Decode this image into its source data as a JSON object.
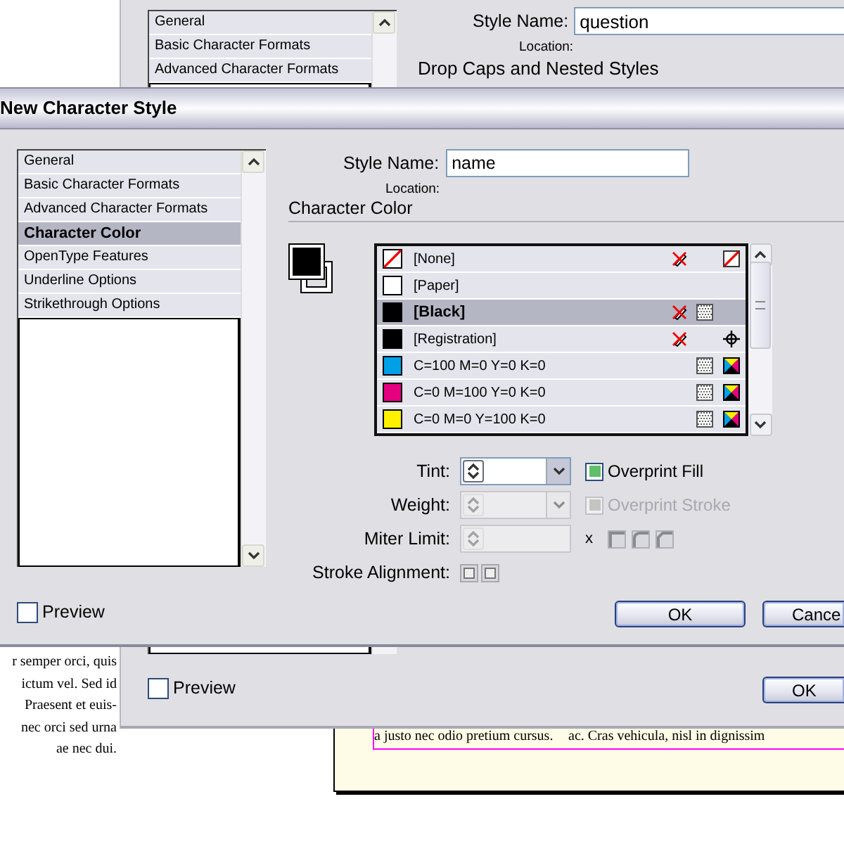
{
  "background_text": {
    "lines": [
      "r semper orci, quis",
      "ictum vel. Sed id",
      "Praesent et euis-",
      "nec orci sed urna",
      "ae nec dui."
    ]
  },
  "document_page": {
    "columns": [
      "a justo nec odio pretium cursus.",
      "ac. Cras vehicula, nisl in dignissim"
    ]
  },
  "back_dialog": {
    "categories": [
      {
        "label": "General",
        "selected": false
      },
      {
        "label": "Basic Character Formats",
        "selected": false
      },
      {
        "label": "Advanced Character Formats",
        "selected": false
      }
    ],
    "style_name": {
      "label": "Style Name:",
      "value": "question"
    },
    "location_label": "Location:",
    "section_title": "Drop Caps and Nested Styles",
    "preview": {
      "label": "Preview",
      "checked": false
    },
    "buttons": [
      "OK"
    ]
  },
  "dialog": {
    "title": "New Character Style",
    "categories": [
      {
        "label": "General",
        "selected": false
      },
      {
        "label": "Basic Character Formats",
        "selected": false
      },
      {
        "label": "Advanced Character Formats",
        "selected": false
      },
      {
        "label": "Character Color",
        "selected": true
      },
      {
        "label": "OpenType Features",
        "selected": false
      },
      {
        "label": "Underline Options",
        "selected": false
      },
      {
        "label": "Strikethrough Options",
        "selected": false
      }
    ],
    "style_name": {
      "label": "Style Name:",
      "value": "name"
    },
    "location_label": "Location:",
    "section_title": "Character Color",
    "swatches": [
      {
        "name": "[None]",
        "kind": "none",
        "locked": true,
        "selected": false
      },
      {
        "name": "[Paper]",
        "kind": "paper",
        "color": "#ffffff",
        "locked": false,
        "selected": false
      },
      {
        "name": "[Black]",
        "kind": "black",
        "color": "#000000",
        "locked": true,
        "selected": true
      },
      {
        "name": "[Registration]",
        "kind": "registration",
        "color": "#000000",
        "locked": true,
        "selected": false
      },
      {
        "name": "C=100 M=0 Y=0 K=0",
        "kind": "process",
        "color": "#00a0e9",
        "locked": false,
        "selected": false
      },
      {
        "name": "C=0 M=100 Y=0 K=0",
        "kind": "process",
        "color": "#e4007f",
        "locked": false,
        "selected": false
      },
      {
        "name": "C=0 M=0 Y=100 K=0",
        "kind": "process",
        "color": "#fff000",
        "locked": false,
        "selected": false
      }
    ],
    "tint": {
      "label": "Tint:",
      "disabled": false
    },
    "weight": {
      "label": "Weight:",
      "disabled": true
    },
    "miter_limit": {
      "label": "Miter Limit:",
      "unit": "x",
      "disabled": true
    },
    "stroke_alignment": {
      "label": "Stroke Alignment:"
    },
    "overprint_fill": {
      "label": "Overprint Fill",
      "checked": true,
      "disabled": false
    },
    "overprint_stroke": {
      "label": "Overprint Stroke",
      "checked": true,
      "disabled": true
    },
    "preview": {
      "label": "Preview",
      "checked": false
    },
    "buttons": [
      "OK",
      "Cance"
    ]
  }
}
